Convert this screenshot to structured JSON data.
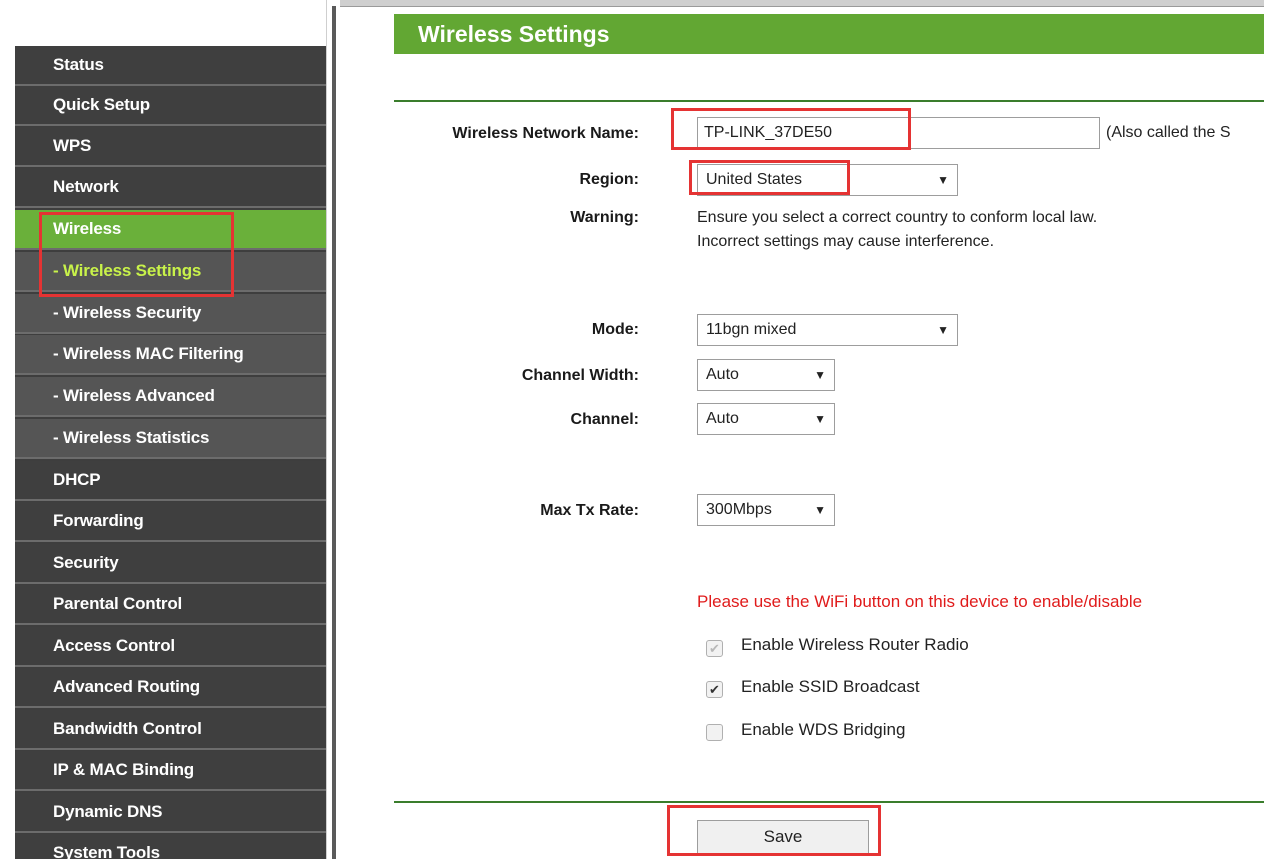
{
  "sidebar": {
    "items": [
      {
        "label": "Status"
      },
      {
        "label": "Quick Setup"
      },
      {
        "label": "WPS"
      },
      {
        "label": "Network"
      },
      {
        "label": "Wireless"
      },
      {
        "label": "- Wireless Settings"
      },
      {
        "label": "- Wireless Security"
      },
      {
        "label": "- Wireless MAC Filtering"
      },
      {
        "label": "- Wireless Advanced"
      },
      {
        "label": "- Wireless Statistics"
      },
      {
        "label": "DHCP"
      },
      {
        "label": "Forwarding"
      },
      {
        "label": "Security"
      },
      {
        "label": "Parental Control"
      },
      {
        "label": "Access Control"
      },
      {
        "label": "Advanced Routing"
      },
      {
        "label": "Bandwidth Control"
      },
      {
        "label": "IP & MAC Binding"
      },
      {
        "label": "Dynamic DNS"
      },
      {
        "label": "System Tools"
      }
    ],
    "active_color": "#6ab03a",
    "current_sub_color": "#c8f24a"
  },
  "main": {
    "title": "Wireless Settings",
    "fields": {
      "ssid_label": "Wireless Network Name:",
      "ssid_value": "TP-LINK_37DE50",
      "ssid_note": "(Also called the S",
      "region_label": "Region:",
      "region_value": "United States",
      "warning_label": "Warning:",
      "warning_line1": "Ensure you select a correct country to conform local law.",
      "warning_line2": "Incorrect settings may cause interference.",
      "mode_label": "Mode:",
      "mode_value": "11bgn mixed",
      "width_label": "Channel Width:",
      "width_value": "Auto",
      "channel_label": "Channel:",
      "channel_value": "Auto",
      "rate_label": "Max Tx Rate:",
      "rate_value": "300Mbps"
    },
    "notice": "Please use the WiFi button on this device to enable/disable",
    "notice_color": "#e01b1b",
    "checkboxes": [
      {
        "label": "Enable Wireless Router Radio",
        "checked": true,
        "disabled": true
      },
      {
        "label": "Enable SSID Broadcast",
        "checked": true,
        "disabled": false
      },
      {
        "label": "Enable WDS Bridging",
        "checked": false,
        "disabled": false
      }
    ],
    "save_label": "Save",
    "dropdown_icon": "triangle-down-icon",
    "highlight_color": "#e53333"
  }
}
